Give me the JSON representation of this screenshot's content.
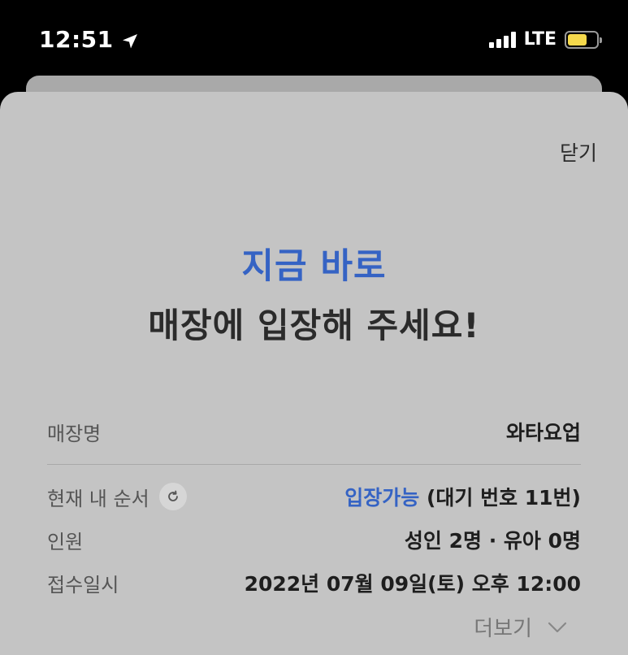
{
  "status_bar": {
    "time": "12:51",
    "network": "LTE",
    "battery_level": 0.68
  },
  "sheet": {
    "close_label": "닫기",
    "headline_accent": "지금 바로",
    "headline_main": "매장에 입장해 주세요!",
    "rows": [
      {
        "label": "매장명",
        "value": "와타요업"
      },
      {
        "label": "현재 내 순서",
        "value_accent": "입장가능",
        "value": "(대기 번호 11번)"
      },
      {
        "label": "인원",
        "value": "성인 2명 · 유아 0명"
      },
      {
        "label": "접수일시",
        "value": "2022년 07월 09일(토) 오후 12:00"
      }
    ],
    "more_label": "더보기"
  },
  "colors": {
    "accent": "#3563c4",
    "sheet_background": "#c4c4c4",
    "battery": "#f5d94c"
  }
}
